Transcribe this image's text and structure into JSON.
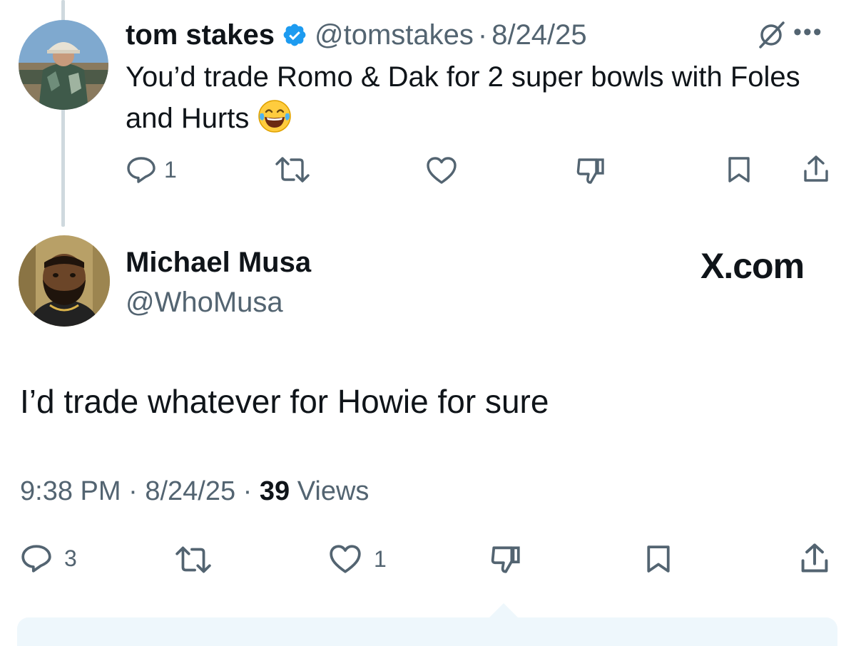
{
  "parent_tweet": {
    "author_name": "tom stakes",
    "handle": "@tomstakes",
    "separator": "·",
    "date": "8/24/25",
    "text": "You’d trade Romo & Dak for 2 super bowls with Foles and Hurts",
    "emoji": "face-with-tears-of-joy",
    "verified": true,
    "icons": [
      "grok-icon",
      "more-icon"
    ],
    "actions": {
      "reply_count": "1",
      "retweet_count": "",
      "like_count": "",
      "dislike_count": ""
    }
  },
  "reply_tweet": {
    "author_name": "Michael Musa",
    "handle": "@WhoMusa",
    "text": "I’d trade whatever for Howie for sure",
    "time": "9:38 PM",
    "separator": "·",
    "date": "8/24/25",
    "views_count": "39",
    "views_label": "Views",
    "actions": {
      "reply_count": "3",
      "retweet_count": "",
      "like_count": "1",
      "dislike_count": ""
    }
  },
  "brand_label": "X.com",
  "colors": {
    "text": "#0f1419",
    "secondary": "#536471",
    "verified": "#1d9bf0",
    "thread_line": "#cfd9de",
    "compose_bg": "#eef7fc"
  }
}
